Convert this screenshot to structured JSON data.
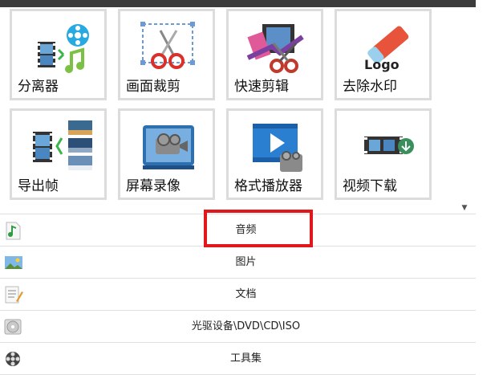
{
  "tools": [
    {
      "label": "分离器",
      "icon": "separator-icon"
    },
    {
      "label": "画面裁剪",
      "icon": "crop-scissors-icon"
    },
    {
      "label": "快速剪辑",
      "icon": "quick-cut-icon"
    },
    {
      "label": "去除水印",
      "icon": "eraser-logo-icon"
    },
    {
      "label": "导出帧",
      "icon": "export-frames-icon"
    },
    {
      "label": "屏幕录像",
      "icon": "screen-record-icon"
    },
    {
      "label": "格式播放器",
      "icon": "player-icon"
    },
    {
      "label": "视频下载",
      "icon": "video-download-icon"
    }
  ],
  "logo_text": "Logo",
  "scroll_arrow": "▼",
  "categories": [
    {
      "label": "音频",
      "icon": "audio-file-icon"
    },
    {
      "label": "图片",
      "icon": "picture-icon"
    },
    {
      "label": "文档",
      "icon": "document-icon"
    },
    {
      "label": "光驱设备\\DVD\\CD\\ISO",
      "icon": "disc-icon"
    },
    {
      "label": "工具集",
      "icon": "film-reel-icon"
    }
  ],
  "colors": {
    "highlight": "#e0181c",
    "tile_border": "#dcdcdc",
    "topbar": "#3c3c3c"
  }
}
